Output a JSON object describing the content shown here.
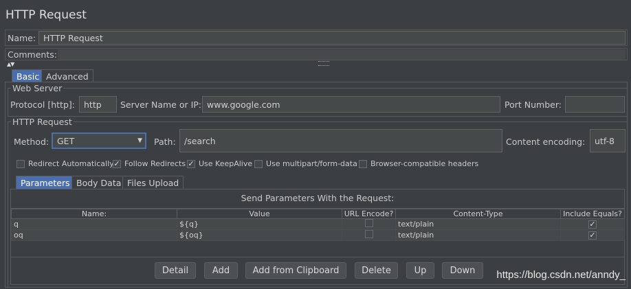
{
  "window": {
    "title": "HTTP Request"
  },
  "name": {
    "label": "Name:",
    "value": "HTTP Request"
  },
  "comments": {
    "label": "Comments:",
    "value": ""
  },
  "outer_tabs": [
    {
      "label": "Basic",
      "active": true
    },
    {
      "label": "Advanced",
      "active": false
    }
  ],
  "web_server": {
    "title": "Web Server",
    "protocol_label": "Protocol [http]:",
    "protocol_value": "http",
    "server_label": "Server Name or IP:",
    "server_value": "www.google.com",
    "port_label": "Port Number:",
    "port_value": ""
  },
  "http_request": {
    "title": "HTTP Request",
    "method_label": "Method:",
    "method_value": "GET",
    "path_label": "Path:",
    "path_value": "/search",
    "encoding_label": "Content encoding:",
    "encoding_value": "utf-8"
  },
  "options": [
    {
      "label": "Redirect Automatically",
      "checked": false
    },
    {
      "label": "Follow Redirects",
      "checked": true
    },
    {
      "label": "Use KeepAlive",
      "checked": true
    },
    {
      "label": "Use multipart/form-data",
      "checked": false
    },
    {
      "label": "Browser-compatible headers",
      "checked": false
    }
  ],
  "inner_tabs": [
    {
      "label": "Parameters",
      "active": true
    },
    {
      "label": "Body Data",
      "active": false
    },
    {
      "label": "Files Upload",
      "active": false
    }
  ],
  "params": {
    "heading": "Send Parameters With the Request:",
    "columns": [
      "Name:",
      "Value",
      "URL Encode?",
      "Content-Type",
      "Include Equals?"
    ],
    "rows": [
      {
        "name": "q",
        "value": "${q}",
        "url_encode": false,
        "content_type": "text/plain",
        "include_equals": true
      },
      {
        "name": "oq",
        "value": "${oq}",
        "url_encode": false,
        "content_type": "text/plain",
        "include_equals": true
      }
    ]
  },
  "buttons": {
    "detail": "Detail",
    "add": "Add",
    "add_clipboard": "Add from Clipboard",
    "delete": "Delete",
    "up": "Up",
    "down": "Down"
  },
  "watermark": "https://blog.csdn.net/anndy_"
}
